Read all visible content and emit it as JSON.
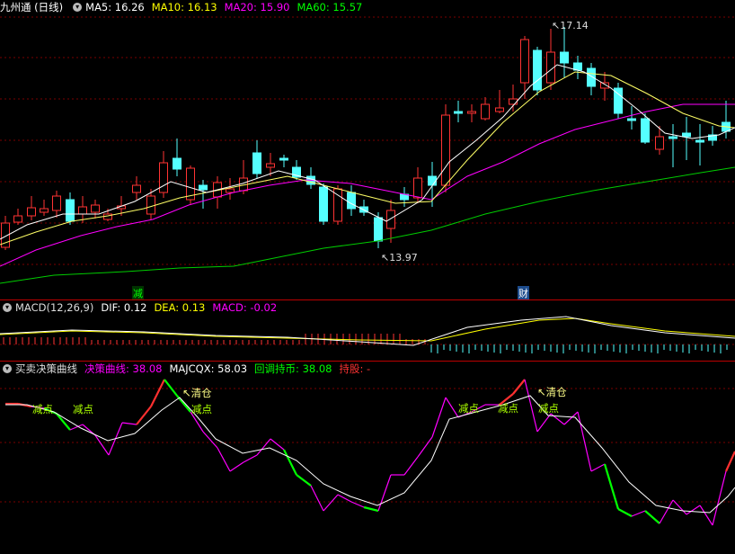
{
  "main": {
    "title": "九州通 (日线)",
    "indicators": [
      {
        "label": "MA5: 16.26",
        "color": "#ffffff"
      },
      {
        "label": "MA10: 16.13",
        "color": "#ffff00"
      },
      {
        "label": "MA20: 15.90",
        "color": "#ff00ff"
      },
      {
        "label": "MA60: 15.57",
        "color": "#00ff00"
      }
    ],
    "high_label": "17.14",
    "low_label": "13.97",
    "markers": [
      {
        "text": "减",
        "color": "#00ff00"
      },
      {
        "text": "财",
        "color": "#ffffff"
      }
    ]
  },
  "macd": {
    "title": "MACD(12,26,9)",
    "indicators": [
      {
        "label": "DIF: 0.12",
        "color": "#ffffff"
      },
      {
        "label": "DEA: 0.13",
        "color": "#ffff00"
      },
      {
        "label": "MACD: -0.02",
        "color": "#ff00ff"
      }
    ]
  },
  "strategy": {
    "title": "买卖决策曲线",
    "indicators": [
      {
        "label": "决策曲线: 38.08",
        "color": "#ff00ff"
      },
      {
        "label": "MAJCQX: 58.03",
        "color": "#ffffff"
      },
      {
        "label": "回调持币: 38.08",
        "color": "#00ff00"
      },
      {
        "label": "持股: -",
        "color": "#ff3030"
      }
    ],
    "annotations": [
      {
        "text": "减点",
        "color": "#aaff00"
      },
      {
        "text": "减点",
        "color": "#aaff00"
      },
      {
        "text": "清仓",
        "color": "#ffff80"
      },
      {
        "text": "减点",
        "color": "#aaff00"
      },
      {
        "text": "减点",
        "color": "#aaff00"
      },
      {
        "text": "减点",
        "color": "#aaff00"
      },
      {
        "text": "减点",
        "color": "#aaff00"
      },
      {
        "text": "清仓",
        "color": "#ffff80"
      }
    ]
  },
  "colors": {
    "up": "#ff3333",
    "down": "#55ffff",
    "grid": "#7a0000",
    "separator": "#b00000"
  }
}
